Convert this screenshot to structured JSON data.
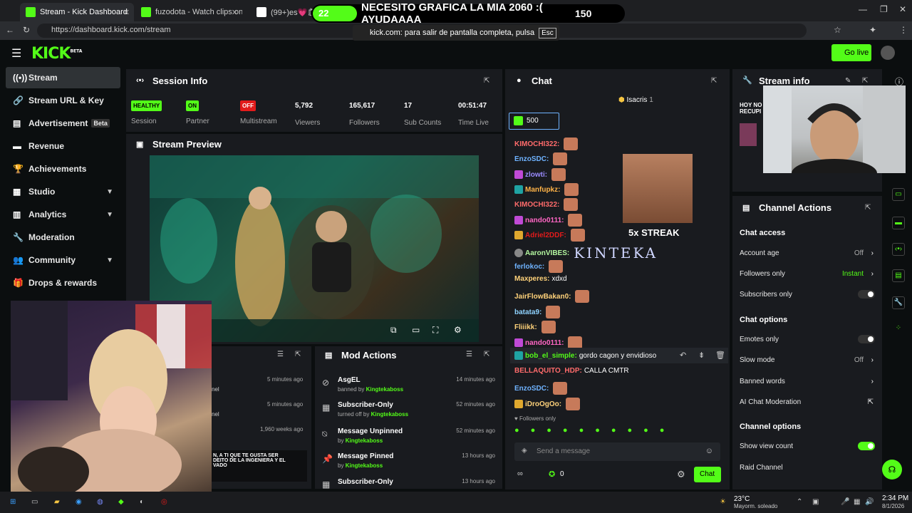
{
  "browser": {
    "tabs": [
      {
        "title": "Stream - Kick Dashboard"
      },
      {
        "title": "fuzodota - Watch clips on Kick"
      },
      {
        "title": "(99+)es💗🛍 | Tik"
      }
    ],
    "url": "https://dashboard.kick.com/stream"
  },
  "overlay": {
    "pill": "22",
    "title": "NECESITO GRAFICA LA MIA 2060 :( AYUDAAAA",
    "count": "150"
  },
  "fullscreen_notice": {
    "text": "kick.com: para salir de pantalla completa, pulsa",
    "key": "Esc"
  },
  "header": {
    "logo": "KICK",
    "logo_tag": "BETA",
    "go_live": "Go live"
  },
  "sidebar": {
    "items": [
      {
        "label": "Stream",
        "icon": "broadcast-icon"
      },
      {
        "label": "Stream URL & Key",
        "icon": "link-icon"
      },
      {
        "label": "Advertisement",
        "icon": "ad-icon",
        "tag": "Beta"
      },
      {
        "label": "Revenue",
        "icon": "money-icon"
      },
      {
        "label": "Achievements",
        "icon": "trophy-icon"
      },
      {
        "label": "Studio",
        "icon": "studio-icon"
      },
      {
        "label": "Analytics",
        "icon": "chart-icon"
      },
      {
        "label": "Moderation",
        "icon": "wrench-icon"
      },
      {
        "label": "Community",
        "icon": "people-icon"
      },
      {
        "label": "Drops & rewards",
        "icon": "gift-icon"
      }
    ]
  },
  "session": {
    "title": "Session Info",
    "stats": [
      {
        "value": "HEALTHY",
        "label": "Session"
      },
      {
        "value": "ON",
        "label": "Partner"
      },
      {
        "value": "OFF",
        "label": "Multistream"
      },
      {
        "value": "5,792",
        "label": "Viewers"
      },
      {
        "value": "165,617",
        "label": "Followers"
      },
      {
        "value": "17",
        "label": "Sub Counts"
      },
      {
        "value": "00:51:47",
        "label": "Time Live"
      }
    ]
  },
  "preview": {
    "title": "Stream Preview"
  },
  "activity": {
    "rows": [
      {
        "time": "5 minutes ago",
        "sub": "nel"
      },
      {
        "time": "5 minutes ago",
        "sub": "nel"
      },
      {
        "time": "1,960 weeks ago",
        "sub": ""
      }
    ],
    "banner": "N, A TI QUE TE GUSTA SER\nDEITO DE LA INGENIERA Y EL\nVADO"
  },
  "mod_actions": {
    "title": "Mod Actions",
    "items": [
      {
        "title": "AsgEL",
        "sub": "banned by",
        "by": "Kingtekaboss",
        "time": "14 minutes ago"
      },
      {
        "title": "Subscriber-Only",
        "sub": "turned off by",
        "by": "Kingtekaboss",
        "time": "52 minutes ago"
      },
      {
        "title": "Message Unpinned",
        "sub": "by",
        "by": "Kingtekaboss",
        "time": "52 minutes ago"
      },
      {
        "title": "Message Pinned",
        "sub": "by",
        "by": "Kingtekaboss",
        "time": "13 hours ago"
      },
      {
        "title": "Subscriber-Only",
        "sub": "",
        "by": "",
        "time": "13 hours ago"
      }
    ]
  },
  "chat": {
    "title": "Chat",
    "top_user": "Isacris",
    "top_count": "1",
    "goal": "500",
    "big_emote_caption": "5x STREAK",
    "kinteka": "KINTEKA",
    "messages": [
      {
        "user": "KIMOCHI322:",
        "text": "",
        "color": "#ff6b6b"
      },
      {
        "user": "EnzoSDC:",
        "text": "",
        "color": "#6fb3ff"
      },
      {
        "user": "zlowti:",
        "text": "",
        "color": "#9b8cff"
      },
      {
        "user": "Manfupkz:",
        "text": "",
        "color": "#ffb347"
      },
      {
        "user": "KIMOCHI322:",
        "text": "",
        "color": "#ff6b6b"
      },
      {
        "user": "nando0111:",
        "text": "",
        "color": "#ff66c4"
      },
      {
        "user": "Adriel2DDF:",
        "text": "",
        "color": "#e21b1b"
      },
      {
        "user": "AaronVIBES:",
        "text": "",
        "color": "#b4f7a0"
      },
      {
        "user": "ferlokoc:",
        "text": "",
        "color": "#6fb3ff"
      },
      {
        "user": "Maxperes:",
        "text": "xdxd",
        "color": "#ffd27a"
      },
      {
        "user": "JairFlowBakan0:",
        "text": "",
        "color": "#ffd27a"
      },
      {
        "user": "batata9:",
        "text": "",
        "color": "#8fd3ff"
      },
      {
        "user": "Fliiikk:",
        "text": "",
        "color": "#ffd27a"
      },
      {
        "user": "nando0111:",
        "text": "",
        "color": "#ff66c4"
      },
      {
        "user": "bob_el_simple:",
        "text": "gordo cagon y envidioso",
        "color": "#53fc18"
      },
      {
        "user": "BELLAQUITO_HDP:",
        "text": "CALLA CMTR",
        "color": "#ff6b6b"
      },
      {
        "user": "EnzoSDC:",
        "text": "",
        "color": "#6fb3ff"
      },
      {
        "user": "iDroOgOo:",
        "text": "",
        "color": "#ffd27a"
      }
    ],
    "followers_only": "Followers only",
    "placeholder": "Send a message",
    "viewers_count": "0",
    "send_label": "Chat"
  },
  "stream_info": {
    "title": "Stream info",
    "preview_text": "HOY NO\nRECUPI"
  },
  "channel_actions": {
    "title": "Channel Actions",
    "chat_access": "Chat access",
    "account_age": {
      "label": "Account age",
      "value": "Off"
    },
    "followers_only": {
      "label": "Followers only",
      "value": "Instant"
    },
    "subscribers_only": "Subscribers only",
    "chat_options": "Chat options",
    "emotes_only": "Emotes only",
    "slow_mode": {
      "label": "Slow mode",
      "value": "Off"
    },
    "banned_words": "Banned words",
    "ai_moderation": "AI Chat Moderation",
    "channel_options": "Channel options",
    "show_view_count": "Show view count",
    "raid_channel": "Raid Channel"
  },
  "taskbar": {
    "temp": "23°C",
    "weather": "Mayorm. soleado",
    "time": "2:34 PM",
    "date": "8/1/2026"
  },
  "colors": {
    "accent": "#53fc18",
    "panel": "#191b1f",
    "bg": "#0b0e0f"
  }
}
